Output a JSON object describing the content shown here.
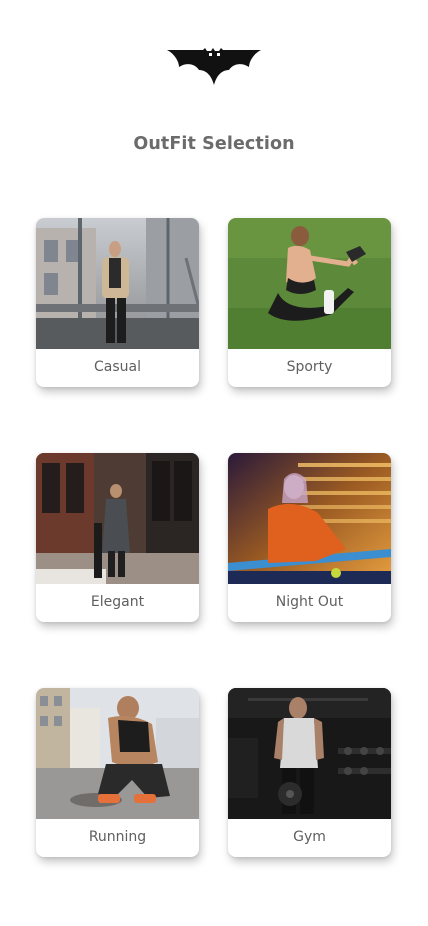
{
  "header": {
    "logo_icon": "bat-logo-icon",
    "title": "OutFit Selection"
  },
  "outfits": [
    {
      "label": "Casual",
      "image": "man-in-beige-jacket-photo"
    },
    {
      "label": "Sporty",
      "image": "woman-stretching-on-grass-photo"
    },
    {
      "label": "Elegant",
      "image": "man-in-coat-by-brick-building-photo"
    },
    {
      "label": "Night Out",
      "image": "woman-in-orange-jacket-at-night-photo"
    },
    {
      "label": "Running",
      "image": "man-tying-running-shoes-photo"
    },
    {
      "label": "Gym",
      "image": "man-in-dark-gym-photo"
    }
  ]
}
